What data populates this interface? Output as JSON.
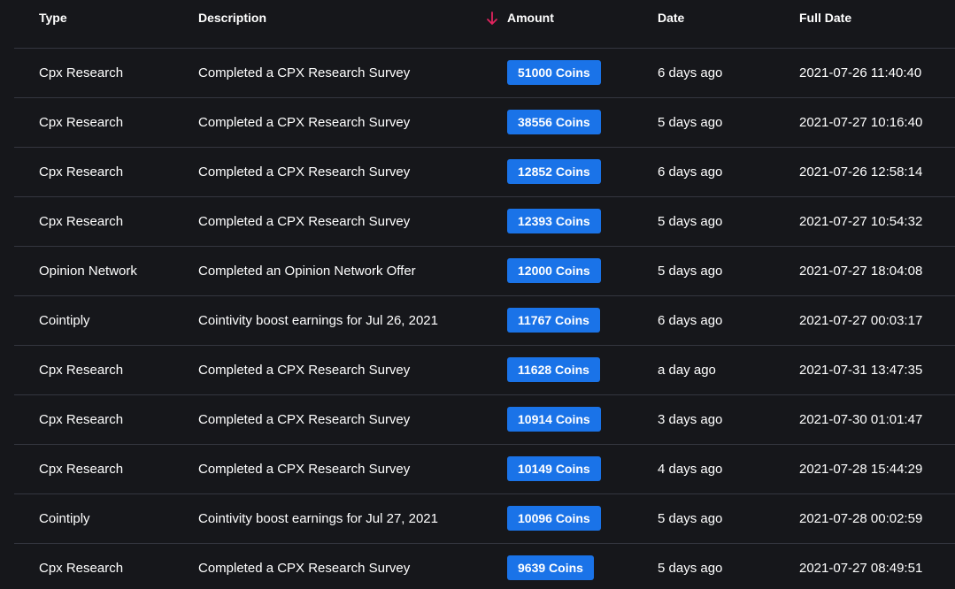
{
  "colors": {
    "background": "#16171b",
    "divider": "#34363f",
    "badge": "#1a73e8",
    "sort_arrow": "#e0245e"
  },
  "columns": {
    "type": "Type",
    "description": "Description",
    "amount": "Amount",
    "date": "Date",
    "full_date": "Full Date",
    "sort_icon": "arrow-down-icon"
  },
  "rows": [
    {
      "type": "Cpx Research",
      "description": "Completed a CPX Research Survey",
      "amount": "51000 Coins",
      "date": "6 days ago",
      "full_date": "2021-07-26 11:40:40"
    },
    {
      "type": "Cpx Research",
      "description": "Completed a CPX Research Survey",
      "amount": "38556 Coins",
      "date": "5 days ago",
      "full_date": "2021-07-27 10:16:40"
    },
    {
      "type": "Cpx Research",
      "description": "Completed a CPX Research Survey",
      "amount": "12852 Coins",
      "date": "6 days ago",
      "full_date": "2021-07-26 12:58:14"
    },
    {
      "type": "Cpx Research",
      "description": "Completed a CPX Research Survey",
      "amount": "12393 Coins",
      "date": "5 days ago",
      "full_date": "2021-07-27 10:54:32"
    },
    {
      "type": "Opinion Network",
      "description": "Completed an Opinion Network Offer",
      "amount": "12000 Coins",
      "date": "5 days ago",
      "full_date": "2021-07-27 18:04:08"
    },
    {
      "type": "Cointiply",
      "description": "Cointivity boost earnings for Jul 26, 2021",
      "amount": "11767 Coins",
      "date": "6 days ago",
      "full_date": "2021-07-27 00:03:17"
    },
    {
      "type": "Cpx Research",
      "description": "Completed a CPX Research Survey",
      "amount": "11628 Coins",
      "date": "a day ago",
      "full_date": "2021-07-31 13:47:35"
    },
    {
      "type": "Cpx Research",
      "description": "Completed a CPX Research Survey",
      "amount": "10914 Coins",
      "date": "3 days ago",
      "full_date": "2021-07-30 01:01:47"
    },
    {
      "type": "Cpx Research",
      "description": "Completed a CPX Research Survey",
      "amount": "10149 Coins",
      "date": "4 days ago",
      "full_date": "2021-07-28 15:44:29"
    },
    {
      "type": "Cointiply",
      "description": "Cointivity boost earnings for Jul 27, 2021",
      "amount": "10096 Coins",
      "date": "5 days ago",
      "full_date": "2021-07-28 00:02:59"
    },
    {
      "type": "Cpx Research",
      "description": "Completed a CPX Research Survey",
      "amount": "9639 Coins",
      "date": "5 days ago",
      "full_date": "2021-07-27 08:49:51"
    }
  ]
}
